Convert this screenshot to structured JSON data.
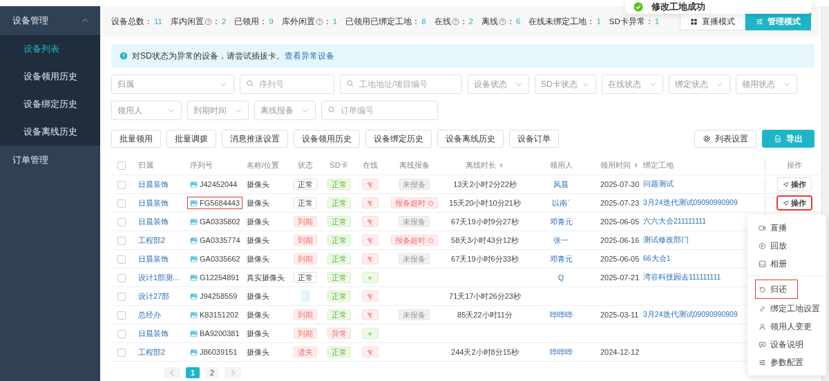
{
  "toast": {
    "message": "修改工地成功"
  },
  "sidebar": {
    "groups": [
      {
        "label": "设备管理",
        "expanded": true,
        "items": [
          {
            "label": "设备列表",
            "selected": true
          },
          {
            "label": "设备领用历史",
            "selected": false
          },
          {
            "label": "设备绑定历史",
            "selected": false
          },
          {
            "label": "设备离线历史",
            "selected": false
          }
        ]
      },
      {
        "label": "订单管理"
      }
    ]
  },
  "stats": [
    {
      "label": "设备总数",
      "help": false,
      "colon": "：",
      "value": "11"
    },
    {
      "label": "库内闲置",
      "help": true,
      "colon": "：",
      "value": "2"
    },
    {
      "label": "已领用",
      "help": false,
      "colon": "：",
      "value": "9"
    },
    {
      "label": "库外闲置",
      "help": true,
      "colon": "：",
      "value": "1"
    },
    {
      "label": "已领用已绑定工地",
      "help": false,
      "colon": "：",
      "value": "8"
    },
    {
      "label": "在线",
      "help": true,
      "colon": "：",
      "value": "2"
    },
    {
      "label": "离线",
      "help": true,
      "colon": "：",
      "value": "6"
    },
    {
      "label": "在线未绑定工地",
      "help": false,
      "colon": "：",
      "value": "1"
    },
    {
      "label": "SD卡异常",
      "help": false,
      "colon": "：",
      "value": "1"
    }
  ],
  "modes": [
    {
      "label": "直播模式",
      "kind": "live",
      "selected": false
    },
    {
      "label": "管理模式",
      "kind": "manage",
      "selected": true
    }
  ],
  "alert": {
    "text": "对SD状态为异常的设备，请尝试插拔卡。",
    "link": "查看异常设备"
  },
  "filters": [
    [
      {
        "kind": "select",
        "placeholder": "归属"
      },
      {
        "kind": "search",
        "placeholder": "序列号"
      },
      {
        "kind": "search",
        "placeholder": "工地地址/项目编号"
      },
      {
        "kind": "select",
        "placeholder": "设备状态"
      },
      {
        "kind": "select",
        "placeholder": "SD卡状态"
      },
      {
        "kind": "select",
        "placeholder": "在线状态"
      },
      {
        "kind": "select",
        "placeholder": "绑定状态"
      },
      {
        "kind": "select",
        "placeholder": "领用状态"
      }
    ],
    [
      {
        "kind": "select",
        "placeholder": "领用人"
      },
      {
        "kind": "select",
        "placeholder": "到期时间"
      },
      {
        "kind": "select",
        "placeholder": "离线报备"
      },
      {
        "kind": "search",
        "placeholder": "订单编号"
      }
    ]
  ],
  "toolbar": {
    "left": [
      "批量领用",
      "批量调拨",
      "消息推送设置",
      "设备领用历史",
      "设备绑定历史",
      "设备离线历史",
      "设备订单"
    ],
    "right": [
      {
        "label": "列表设置",
        "primary": false
      },
      {
        "label": "导出",
        "primary": true
      }
    ]
  },
  "table": {
    "all_checked": false,
    "columns": [
      {
        "label": "归属",
        "sortable": false
      },
      {
        "label": "序列号",
        "sortable": false
      },
      {
        "label": "名称/位置",
        "sortable": false
      },
      {
        "label": "状态",
        "sortable": false
      },
      {
        "label": "SD卡",
        "sortable": false
      },
      {
        "label": "在线",
        "sortable": false
      },
      {
        "label": "离线报备",
        "sortable": false
      },
      {
        "label": "离线时长",
        "sortable": true
      },
      {
        "label": "领用人",
        "sortable": false
      },
      {
        "label": "领用时间",
        "sortable": true
      },
      {
        "label": "绑定工地",
        "sortable": false
      },
      {
        "label": "操作",
        "sortable": false
      }
    ],
    "rows": [
      {
        "checked": false,
        "owner": "日晨装饰",
        "serial": "J42452044",
        "serial_highlighted": false,
        "name": "摄像头",
        "status": {
          "kind": "plain",
          "text": "正常"
        },
        "sd": {
          "kind": "success",
          "text": "正常"
        },
        "online": false,
        "report": {
          "kind": "info",
          "text": "未报备"
        },
        "offline_duration": "13天2小时2分22秒",
        "user": "风晨",
        "claim_date": "2025-07-30",
        "site": "问题测试",
        "action": {
          "label": "操作",
          "highlighted": false
        }
      },
      {
        "checked": false,
        "owner": "日晨装饰",
        "serial": "FG5684443",
        "serial_highlighted": true,
        "name": "摄像头",
        "status": {
          "kind": "plain",
          "text": "正常"
        },
        "sd": {
          "kind": "success",
          "text": "正常"
        },
        "online": false,
        "report": {
          "kind": "overdue",
          "text": "报备超时"
        },
        "offline_duration": "15天20小时10分21秒",
        "user": "以南ˊ",
        "claim_date": "2025-07-23",
        "site": "3月24迭代测试09090990909",
        "action": {
          "label": "操作",
          "highlighted": true
        }
      },
      {
        "checked": false,
        "owner": "日晨装饰",
        "serial": "GA0335802",
        "serial_highlighted": false,
        "name": "摄像头",
        "status": {
          "kind": "danger",
          "text": "到期"
        },
        "sd": {
          "kind": "success",
          "text": "正常"
        },
        "online": false,
        "report": {
          "kind": "info",
          "text": "未报备"
        },
        "offline_duration": "67天19小时9分27秒",
        "user": "邓青元",
        "claim_date": "2025-06-05",
        "site": "六六大会211111111"
      },
      {
        "checked": false,
        "owner": "工程部2",
        "serial": "GA0335774",
        "serial_highlighted": false,
        "name": "摄像头",
        "status": {
          "kind": "danger",
          "text": "到期"
        },
        "sd": {
          "kind": "success",
          "text": "正常"
        },
        "online": false,
        "report": {
          "kind": "overdue",
          "text": "报备超时"
        },
        "offline_duration": "58天3小时43分12秒",
        "user": "张一",
        "claim_date": "2025-06-16",
        "site": "测试修改部门"
      },
      {
        "checked": false,
        "owner": "日晨装饰",
        "serial": "GA0335662",
        "serial_highlighted": false,
        "name": "摄像头",
        "status": {
          "kind": "danger",
          "text": "到期"
        },
        "sd": {
          "kind": "success",
          "text": "正常"
        },
        "online": false,
        "report": {
          "kind": "info",
          "text": "未报备"
        },
        "offline_duration": "67天19小时6分33秒",
        "user": "邓青元",
        "claim_date": "2025-06-05",
        "site": "66大会1"
      },
      {
        "checked": false,
        "owner": "设计1部测...",
        "serial": "G12254891",
        "serial_highlighted": false,
        "name": "真实摄像头",
        "status": {
          "kind": "plain",
          "text": "正常"
        },
        "sd": {
          "kind": "success",
          "text": "正常"
        },
        "online": true,
        "user": "Q",
        "claim_date": "2025-07-21",
        "site": "湾谷科技园去111111111"
      },
      {
        "checked": false,
        "owner": "设计27部",
        "serial": "J94258559",
        "serial_highlighted": false,
        "name": "摄像头",
        "status": {
          "kind": "blank"
        },
        "sd": {
          "kind": "success",
          "text": "正常"
        },
        "online": false,
        "offline_duration": "71天17小时26分23秒"
      },
      {
        "checked": false,
        "owner": "总经办",
        "serial": "K83151202",
        "serial_highlighted": false,
        "name": "摄像头",
        "status": {
          "kind": "danger",
          "text": "到期"
        },
        "sd": {
          "kind": "success",
          "text": "正常"
        },
        "online": false,
        "report": {
          "kind": "info",
          "text": "未报备"
        },
        "offline_duration": "85天22小时11分",
        "user": "哔哔哔",
        "claim_date": "2025-03-11",
        "site": "3月24迭代测试09090990909"
      },
      {
        "checked": false,
        "owner": "日晨装饰",
        "serial": "BA9200381",
        "serial_highlighted": false,
        "name": "摄像头",
        "status": {
          "kind": "danger",
          "text": "到期"
        },
        "sd": {
          "kind": "danger",
          "text": "异常"
        },
        "online": true
      },
      {
        "checked": false,
        "owner": "工程部2",
        "serial": "J86039151",
        "serial_highlighted": false,
        "name": "摄像头",
        "status": {
          "kind": "danger",
          "text": "遗失"
        },
        "sd": {
          "kind": "success",
          "text": "正常"
        },
        "online": false,
        "offline_duration": "244天2小时8分15秒",
        "user": "哔哔哔",
        "claim_date": "2024-12-12"
      }
    ]
  },
  "pagination": {
    "pages": [
      {
        "label": "1",
        "selected": true
      },
      {
        "label": "2",
        "selected": false
      }
    ]
  },
  "menu": {
    "groups": [
      [
        {
          "label": "直播",
          "kind": "live",
          "highlighted": false
        },
        {
          "label": "回放",
          "kind": "playback",
          "highlighted": false
        },
        {
          "label": "相册",
          "kind": "album",
          "highlighted": false
        }
      ],
      [
        {
          "label": "归还",
          "kind": "return",
          "highlighted": true
        },
        {
          "label": "绑定工地设置",
          "kind": "bind",
          "highlighted": false
        },
        {
          "label": "领用人变更",
          "kind": "transfer",
          "highlighted": false
        },
        {
          "label": "设备说明",
          "kind": "note",
          "highlighted": false
        },
        {
          "label": "参数配置",
          "kind": "config",
          "highlighted": false
        }
      ]
    ]
  }
}
